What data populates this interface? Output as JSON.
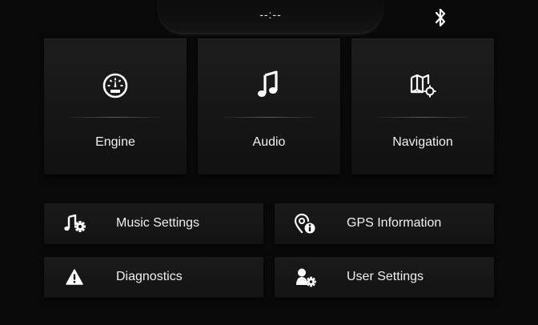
{
  "status_bar": {
    "clock": "--:--",
    "bluetooth_icon": "bluetooth-icon"
  },
  "tiles": [
    {
      "label": "Engine",
      "icon": "gauge-icon"
    },
    {
      "label": "Audio",
      "icon": "music-note-icon"
    },
    {
      "label": "Navigation",
      "icon": "map-icon"
    }
  ],
  "rows": [
    {
      "label": "Music Settings",
      "icon": "music-settings-icon"
    },
    {
      "label": "GPS Information",
      "icon": "gps-info-icon"
    },
    {
      "label": "Diagnostics",
      "icon": "warning-icon"
    },
    {
      "label": "User Settings",
      "icon": "user-settings-icon"
    }
  ]
}
